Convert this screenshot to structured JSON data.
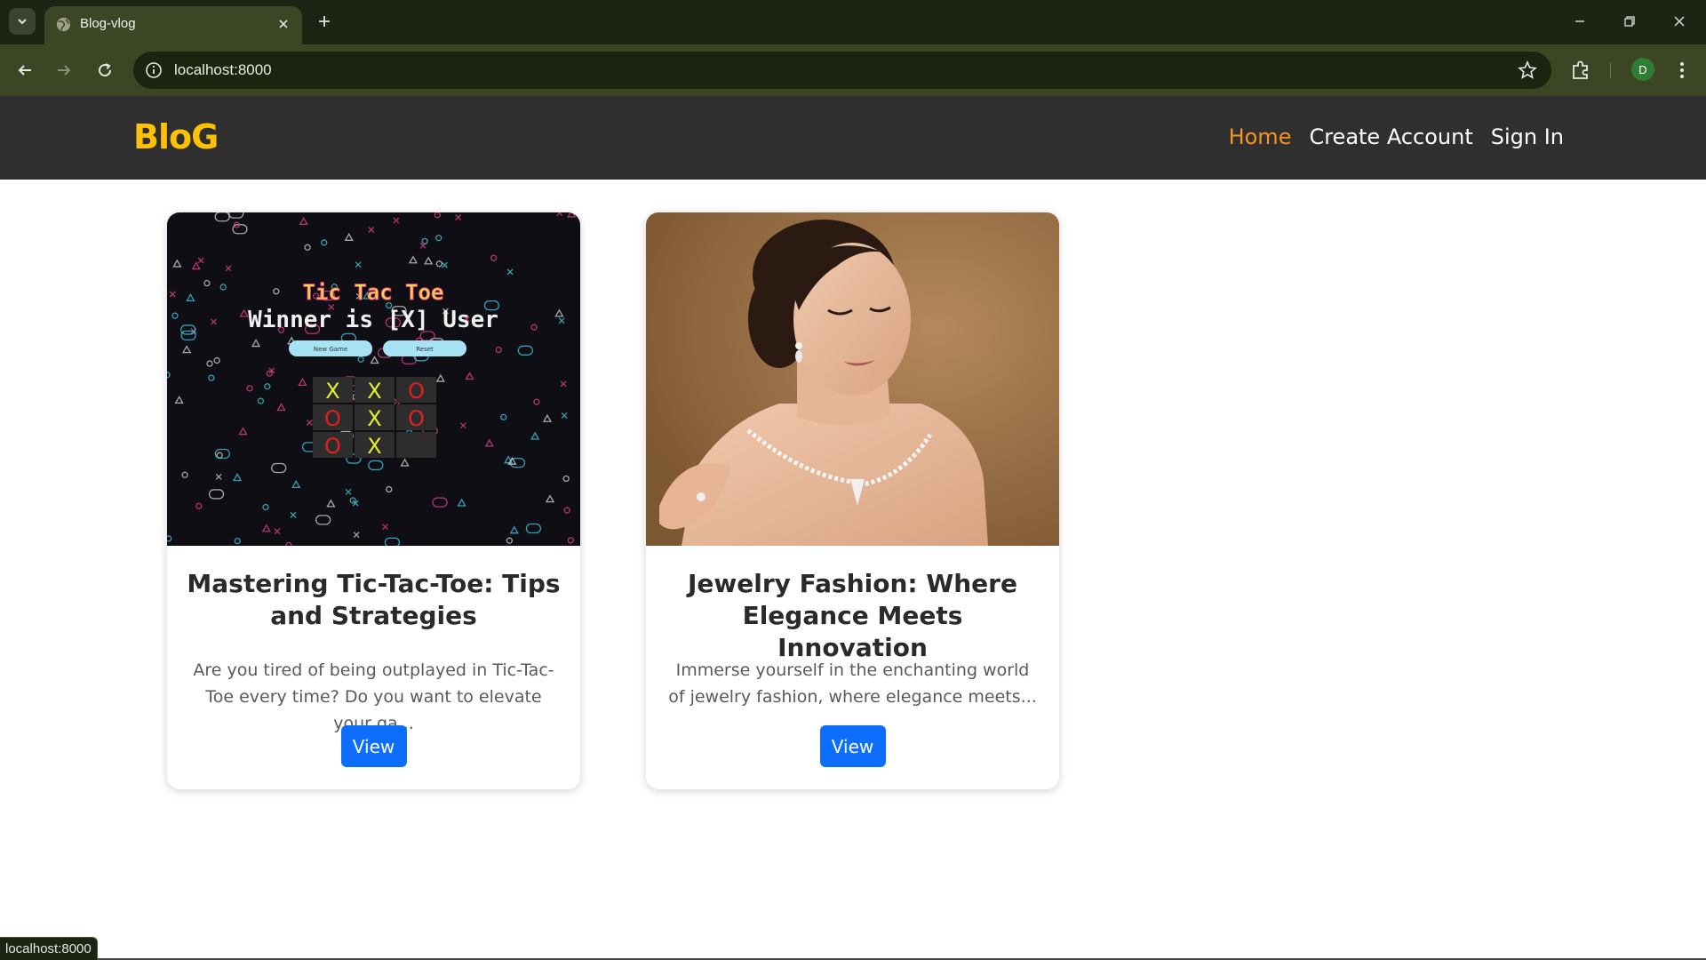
{
  "browser": {
    "tab_title": "Blog-vlog",
    "url": "localhost:8000",
    "profile_initial": "D",
    "status_url": "localhost:8000"
  },
  "site": {
    "brand": "BloG",
    "nav": {
      "home": "Home",
      "create_account": "Create Account",
      "sign_in": "Sign In"
    },
    "accent_color": "#ffc107",
    "active_link_color": "#f7941d",
    "button_color": "#0d6efd"
  },
  "cards": [
    {
      "image": "tic-tac-toe-game-screenshot",
      "image_text": {
        "heading": "Tic Tac Toe",
        "winner": "Winner is [X] User",
        "new_game": "New Game",
        "reset": "Reset",
        "board": [
          "X",
          "X",
          "O",
          "O",
          "X",
          "O",
          "O",
          "X",
          ""
        ]
      },
      "title": "Mastering Tic-Tac-Toe: Tips and Strategies",
      "excerpt": "Are you tired of being outplayed in Tic-Tac-Toe every time? Do you want to elevate your ga...",
      "button": "View"
    },
    {
      "image": "woman-with-jewelry-photo",
      "title": "Jewelry Fashion: Where Elegance Meets Innovation",
      "excerpt": "Immerse yourself in the enchanting world of jewelry fashion, where elegance meets...",
      "button": "View"
    }
  ]
}
